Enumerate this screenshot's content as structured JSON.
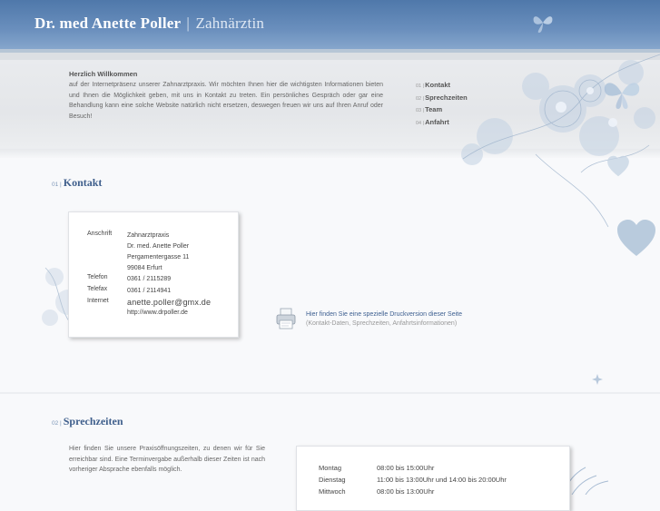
{
  "header": {
    "name": "Dr. med Anette Poller",
    "separator": "|",
    "subtitle": "Zahnärztin"
  },
  "intro": {
    "heading": "Herzlich Willkommen",
    "text": "auf der Internetpräsenz unserer Zahnarztpraxis. Wir möchten Ihnen hier die wichtigsten Informationen bieten und Ihnen die Möglichkeit geben, mit uns in Kontakt zu treten. Ein persönliches Gespräch oder gar eine Behandlung kann eine solche Website natürlich nicht ersetzen, deswegen freuen wir uns auf Ihren Anruf oder Besuch!"
  },
  "quicknav": [
    {
      "num": "01 |",
      "label": "Kontakt"
    },
    {
      "num": "02 |",
      "label": "Sprechzeiten"
    },
    {
      "num": "03 |",
      "label": "Team"
    },
    {
      "num": "04 |",
      "label": "Anfahrt"
    }
  ],
  "kontakt": {
    "num": "01 |",
    "title": "Kontakt",
    "labels": {
      "anschrift": "Anschrift",
      "telefon": "Telefon",
      "telefax": "Telefax",
      "internet": "Internet"
    },
    "address": [
      "Zahnarztpraxis",
      "Dr. med. Anette Poller",
      "Pergamentergasse 11",
      "99084 Erfurt"
    ],
    "telefon": "0361 / 2115289",
    "telefax": "0361 / 2114941",
    "email": "anette.poller@gmx.de",
    "website": "http://www.drpoller.de"
  },
  "print": {
    "link": "Hier finden Sie eine spezielle Druckversion dieser Seite",
    "note": "(Kontakt-Daten, Sprechzeiten, Anfahrtsinformationen)"
  },
  "sprechzeiten": {
    "num": "02 |",
    "title": "Sprechzeiten",
    "text": "Hier finden Sie unsere Praxisöffnungszeiten, zu denen wir für Sie erreichbar sind. Eine Terminvergabe außerhalb dieser Zeiten ist nach vorheriger Absprache ebenfalls möglich.",
    "hours": [
      {
        "day": "Montag",
        "time": "08:00 bis 15:00Uhr"
      },
      {
        "day": "Dienstag",
        "time": "11:00 bis 13:00Uhr und 14:00 bis 20:00Uhr"
      },
      {
        "day": "Mittwoch",
        "time": "08:00 bis 13:00Uhr"
      }
    ]
  },
  "colors": {
    "header_blue": "#5a80b0",
    "title_blue": "#3f5f8c",
    "link_blue": "#3d5f90"
  },
  "icons": {
    "butterfly": "butterfly-icon",
    "heart": "heart-icon",
    "printer": "printer-icon"
  }
}
